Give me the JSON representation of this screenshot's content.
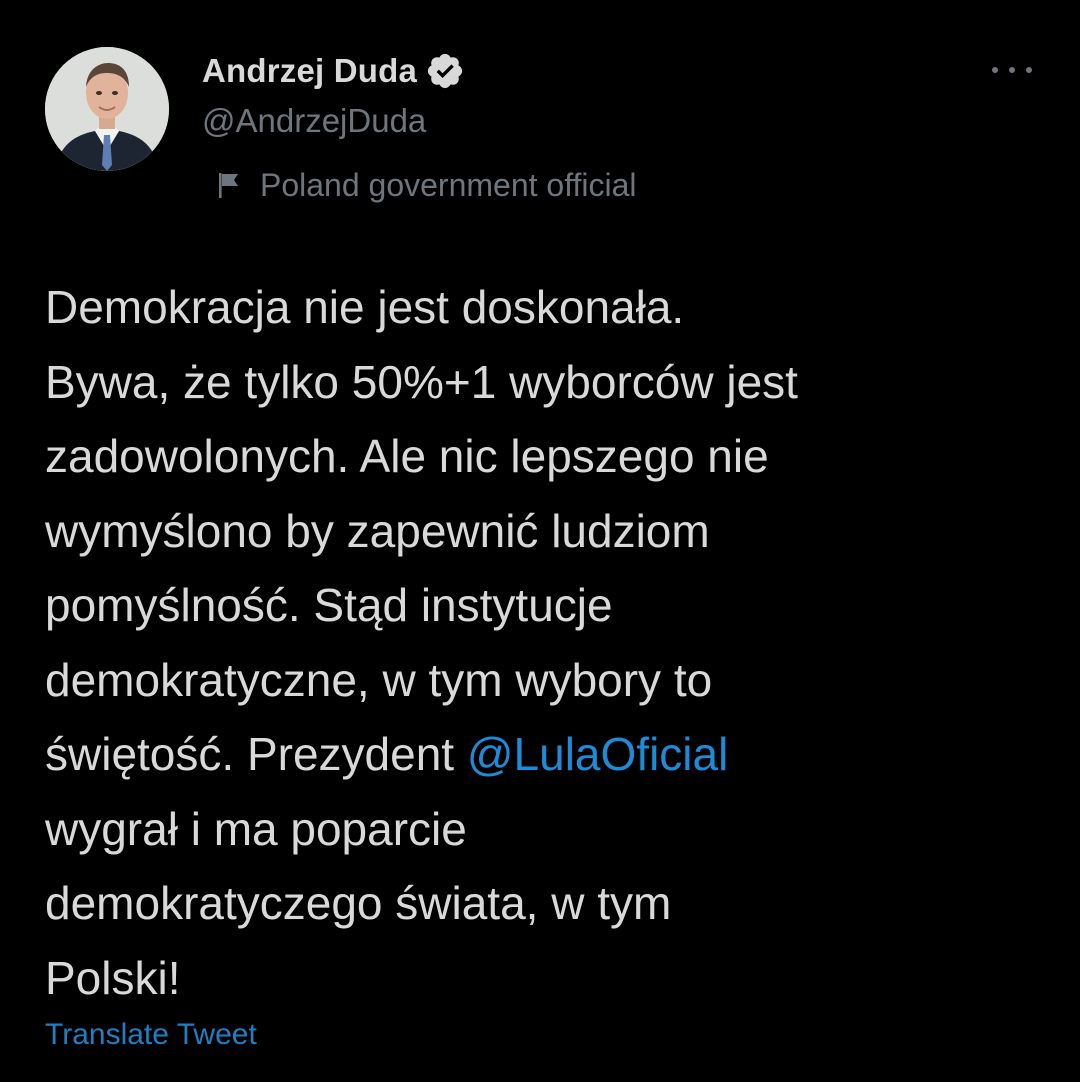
{
  "user": {
    "display_name": "Andrzej Duda",
    "handle": "@AndrzejDuda",
    "verified_icon": "verified-badge-icon",
    "label_icon": "flag-icon",
    "label": "Poland government official"
  },
  "menu": {
    "more_icon": "more-dots-icon"
  },
  "tweet": {
    "text_before_mention": "Demokracja nie jest doskonała.\nBywa, że tylko 50%+1 wyborców jest\nzadowolonych. Ale nic lepszego nie\nwymyślono by zapewnić ludziom\npomyślność. Stąd instytucje\ndemokratyczne, w tym wybory to\nświętość. Prezydent ",
    "mention": "@LulaOficial",
    "text_after_mention": "\nwygrał i ma poparcie\ndemokratyczego świata, w tym\nPolski!",
    "translate_label": "Translate Tweet"
  },
  "colors": {
    "background": "#000000",
    "text": "#d9d9d9",
    "secondary": "#6e767d",
    "link": "#1d8bd8",
    "verified": "#d9d9d9"
  }
}
